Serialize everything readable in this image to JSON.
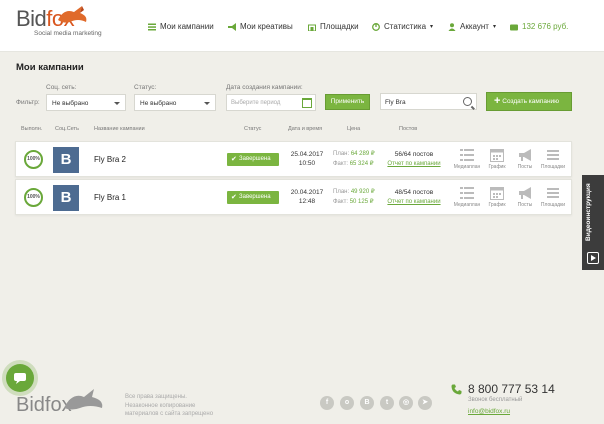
{
  "header": {
    "logo_main_a": "Bid",
    "logo_main_b": "fox",
    "logo_sub": "Social media marketing",
    "nav": {
      "campaigns": "Мои кампании",
      "creatives": "Мои креативы",
      "platforms": "Площадки",
      "statistics": "Статистика",
      "account": "Аккаунт",
      "balance": "132 676 руб."
    }
  },
  "page": {
    "title": "Мои кампании"
  },
  "filters": {
    "filter_label": "Фильтр:",
    "social_label": "Соц. сеть:",
    "social_value": "Не выбрано",
    "status_label": "Статус:",
    "status_value": "Не выбрано",
    "date_label": "Дата создания кампании:",
    "date_placeholder": "Выберите период",
    "apply_label": "Применить",
    "search_value": "Fly Bra",
    "create_label": "Создать кампанию"
  },
  "table": {
    "headers": {
      "done": "Выполн.",
      "network": "Соц.Сеть",
      "name": "Название кампании",
      "status": "Статус",
      "datetime": "Дата и время",
      "price": "Цена",
      "posts": "Постов"
    },
    "actions": [
      "Медиаплан",
      "График",
      "Посты",
      "Площадки"
    ],
    "rows": [
      {
        "pct": "100%",
        "network": "В",
        "name": "Fly Bra 2",
        "status": "Завершена",
        "date": "25.04.2017",
        "time": "10:50",
        "plan_label": "План:",
        "plan": "64 289 ₽",
        "fact_label": "Факт:",
        "fact": "65 324 ₽",
        "posts": "56/64 постов",
        "report": "Отчет по кампании"
      },
      {
        "pct": "100%",
        "network": "В",
        "name": "Fly Bra 1",
        "status": "Завершена",
        "date": "20.04.2017",
        "time": "12:48",
        "plan_label": "План:",
        "plan": "49 920 ₽",
        "fact_label": "Факт:",
        "fact": "50 125 ₽",
        "posts": "48/54 постов",
        "report": "Отчет по кампании"
      }
    ]
  },
  "side": {
    "video": "Видеоинструкция"
  },
  "footer": {
    "logo": "Bidfox",
    "rights": [
      "Все права защищены.",
      "Незаконное копирование",
      "материалов с сайта запрещено"
    ],
    "social": [
      "f",
      "о",
      "В",
      "t",
      "◎",
      "➤"
    ],
    "phone": "8 800 777 53 14",
    "free": "Звонок бесплатный",
    "email": "info@bidfox.ru"
  },
  "colors": {
    "accent": "#7bb540",
    "vk": "#4d6b91",
    "brand_orange": "#d9561f"
  }
}
